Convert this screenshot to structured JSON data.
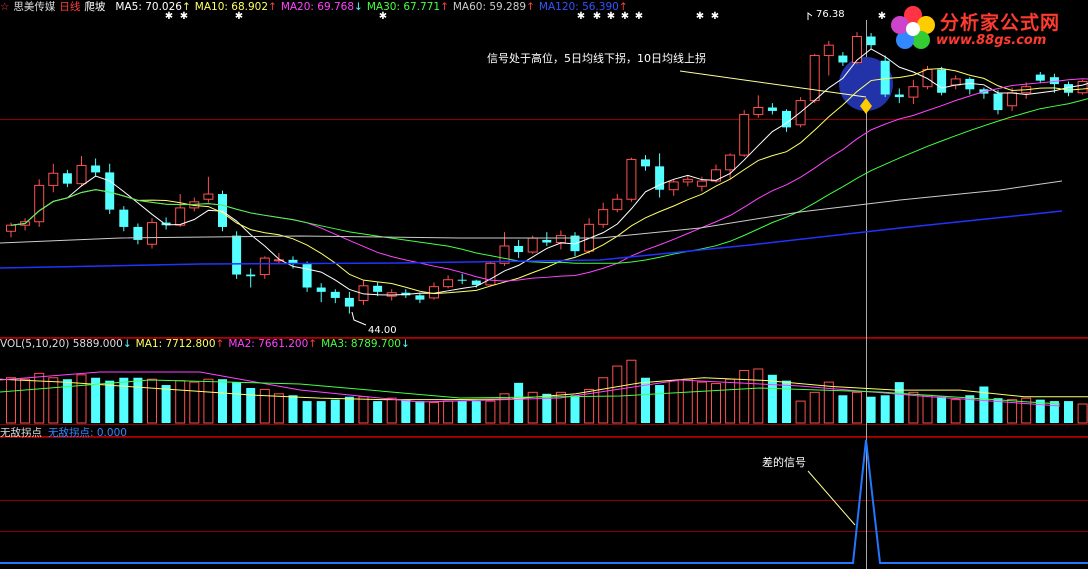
{
  "header": {
    "stock_name": "思美传媒",
    "period": "日线",
    "formula": "爬坡",
    "ma5": "MA5: 70.026",
    "ma5_arrow": "↑",
    "ma10": "MA10: 68.902",
    "ma10_arrow": "↑",
    "ma20": "MA20: 69.768",
    "ma20_arrow": "↓",
    "ma30": "MA30: 67.771",
    "ma30_arrow": "↑",
    "ma60": "MA60: 59.289",
    "ma60_arrow": "↑",
    "ma120": "MA120: 56.390",
    "ma120_arrow": "↑"
  },
  "vol_header": {
    "vol": "VOL(5,10,20)  5889.000",
    "vol_arrow": "↓",
    "ma1": "MA1: 7712.800",
    "ma1_arrow": "↑",
    "ma2": "MA2: 7661.200",
    "ma2_arrow": "↑",
    "ma3": "MA3: 8789.700",
    "ma3_arrow": "↓"
  },
  "ind_header": {
    "name": "无敌拐点",
    "value": "无敌拐点: 0.000"
  },
  "annotations": {
    "signal_text": "信号处于高位，5日均线下拐，10日均线上拐",
    "bad_signal": "差的信号",
    "high_label": "76.38",
    "low_label": "44.00"
  },
  "logo": {
    "title": "分析家公式网",
    "url": "www.88gs.com"
  },
  "colors": {
    "up": "#ff5050",
    "down": "#54ffff",
    "ma5": "#ffffff",
    "ma10": "#ffff66",
    "ma20": "#ff44ff",
    "ma30": "#44ff44",
    "ma60": "#cccccc",
    "ma120": "#2233ff",
    "grid": "#8b0000",
    "indicator": "#2277ff"
  },
  "chart_data": {
    "type": "candlestick",
    "price_range": [
      41.4,
      78.6
    ],
    "candles": [
      [
        53.5,
        54.5,
        52.8,
        54.2
      ],
      [
        54.2,
        55.0,
        53.6,
        54.6
      ],
      [
        54.6,
        59.5,
        54.0,
        58.8
      ],
      [
        58.8,
        61.3,
        58.0,
        60.2
      ],
      [
        60.2,
        60.6,
        58.6,
        59.0
      ],
      [
        59.0,
        62.2,
        58.7,
        61.1
      ],
      [
        61.1,
        61.9,
        59.8,
        60.3
      ],
      [
        60.3,
        61.3,
        55.5,
        56.0
      ],
      [
        56.0,
        56.4,
        53.5,
        54.0
      ],
      [
        54.0,
        54.4,
        52.0,
        52.5
      ],
      [
        52.0,
        55.0,
        51.5,
        54.5
      ],
      [
        54.5,
        55.1,
        53.7,
        54.2
      ],
      [
        54.2,
        57.8,
        54.0,
        56.2
      ],
      [
        56.2,
        57.4,
        55.8,
        56.9
      ],
      [
        57.2,
        59.8,
        56.8,
        57.8
      ],
      [
        57.8,
        58.2,
        53.5,
        54.0
      ],
      [
        53.0,
        53.5,
        48.0,
        48.5
      ],
      [
        48.5,
        49.2,
        47.0,
        48.3
      ],
      [
        48.5,
        50.6,
        48.0,
        50.4
      ],
      [
        50.2,
        51.0,
        49.8,
        50.2
      ],
      [
        50.2,
        50.6,
        49.2,
        49.8
      ],
      [
        49.8,
        50.0,
        46.5,
        47.0
      ],
      [
        47.0,
        47.5,
        45.3,
        46.5
      ],
      [
        46.5,
        46.8,
        45.2,
        45.8
      ],
      [
        45.8,
        46.5,
        44.0,
        44.8
      ],
      [
        45.5,
        47.8,
        45.0,
        47.2
      ],
      [
        47.2,
        47.6,
        46.0,
        46.5
      ],
      [
        46.0,
        46.8,
        45.5,
        46.4
      ],
      [
        46.4,
        46.8,
        45.8,
        46.1
      ],
      [
        46.1,
        46.3,
        45.2,
        45.6
      ],
      [
        45.8,
        47.6,
        45.6,
        47.1
      ],
      [
        47.1,
        48.4,
        46.9,
        47.9
      ],
      [
        47.9,
        48.6,
        47.4,
        47.8
      ],
      [
        47.8,
        47.9,
        47.0,
        47.3
      ],
      [
        47.3,
        50.0,
        47.2,
        49.8
      ],
      [
        49.8,
        53.4,
        49.5,
        51.8
      ],
      [
        51.8,
        52.5,
        50.4,
        51.1
      ],
      [
        51.1,
        53.0,
        50.9,
        52.7
      ],
      [
        52.5,
        53.4,
        51.8,
        52.2
      ],
      [
        52.2,
        53.6,
        51.4,
        53.0
      ],
      [
        53.0,
        53.4,
        50.6,
        51.2
      ],
      [
        51.2,
        55.0,
        50.9,
        54.3
      ],
      [
        54.3,
        56.8,
        53.9,
        56.0
      ],
      [
        56.0,
        57.8,
        55.7,
        57.2
      ],
      [
        57.2,
        62.0,
        56.9,
        61.8
      ],
      [
        61.8,
        62.3,
        60.5,
        61.0
      ],
      [
        61.0,
        62.5,
        57.4,
        58.3
      ],
      [
        58.3,
        59.5,
        57.6,
        59.2
      ],
      [
        59.2,
        60.0,
        58.7,
        59.5
      ],
      [
        58.7,
        59.8,
        58.1,
        59.3
      ],
      [
        59.3,
        61.2,
        59.1,
        60.6
      ],
      [
        60.6,
        62.5,
        59.6,
        62.3
      ],
      [
        62.3,
        67.5,
        62.1,
        67.0
      ],
      [
        67.0,
        69.2,
        66.6,
        67.8
      ],
      [
        67.8,
        68.3,
        67.0,
        67.4
      ],
      [
        67.4,
        67.6,
        65.0,
        65.5
      ],
      [
        65.8,
        69.0,
        65.5,
        68.6
      ],
      [
        68.6,
        74.0,
        68.3,
        73.8
      ],
      [
        73.8,
        75.5,
        71.5,
        75.0
      ],
      [
        73.8,
        74.2,
        72.6,
        73.0
      ],
      [
        73.0,
        76.5,
        72.8,
        76.0
      ],
      [
        76.0,
        76.4,
        74.5,
        75.0
      ],
      [
        73.2,
        73.8,
        69.0,
        69.3
      ],
      [
        69.3,
        70.0,
        68.3,
        69.0
      ],
      [
        69.0,
        71.0,
        68.2,
        70.2
      ],
      [
        70.2,
        72.6,
        69.9,
        72.2
      ],
      [
        72.2,
        72.5,
        69.2,
        69.5
      ],
      [
        70.4,
        71.5,
        69.9,
        71.1
      ],
      [
        71.1,
        71.3,
        69.3,
        69.9
      ],
      [
        69.9,
        70.1,
        68.8,
        69.4
      ],
      [
        69.4,
        69.8,
        67.0,
        67.5
      ],
      [
        68.0,
        70.1,
        67.4,
        69.5
      ],
      [
        69.5,
        70.7,
        68.8,
        70.2
      ],
      [
        71.6,
        71.9,
        70.6,
        70.9
      ],
      [
        71.3,
        71.7,
        69.5,
        70.5
      ],
      [
        70.5,
        70.8,
        69.1,
        69.5
      ],
      [
        69.5,
        71.0,
        69.3,
        70.8
      ],
      [
        70.0,
        73.2,
        69.8,
        72.8
      ],
      [
        72.8,
        74.2,
        71.8,
        73.4
      ],
      [
        73.2,
        73.8,
        72.8,
        74.0
      ]
    ],
    "volumes": [
      0.62,
      0.6,
      0.68,
      0.62,
      0.6,
      0.66,
      0.62,
      0.58,
      0.62,
      0.62,
      0.6,
      0.52,
      0.58,
      0.56,
      0.6,
      0.6,
      0.56,
      0.48,
      0.46,
      0.4,
      0.38,
      0.3,
      0.3,
      0.32,
      0.36,
      0.36,
      0.3,
      0.34,
      0.32,
      0.3,
      0.28,
      0.3,
      0.3,
      0.3,
      0.3,
      0.4,
      0.55,
      0.42,
      0.4,
      0.42,
      0.38,
      0.46,
      0.62,
      0.78,
      0.86,
      0.62,
      0.52,
      0.58,
      0.6,
      0.56,
      0.54,
      0.6,
      0.72,
      0.74,
      0.66,
      0.58,
      0.3,
      0.42,
      0.56,
      0.38,
      0.42,
      0.36,
      0.38,
      0.56,
      0.42,
      0.38,
      0.36,
      0.32,
      0.38,
      0.5,
      0.34,
      0.32,
      0.34,
      0.32,
      0.3,
      0.3,
      0.26,
      0.3,
      0.3,
      0.26
    ],
    "volume_ma": [
      0.6,
      0.56,
      0.5,
      0.44,
      0.38,
      0.34,
      0.32,
      0.32,
      0.33,
      0.4,
      0.55,
      0.62,
      0.58,
      0.5,
      0.45,
      0.45,
      0.36,
      0.36
    ]
  }
}
